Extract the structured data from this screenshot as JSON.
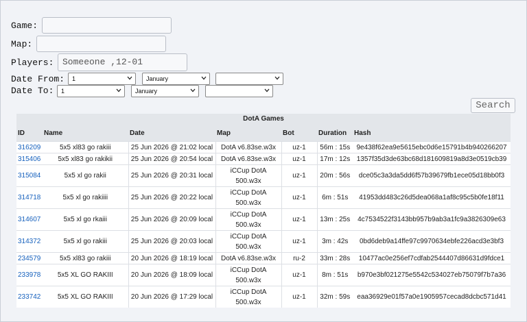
{
  "form": {
    "game_label": "Game:",
    "game_value": "",
    "map_label": "Map:",
    "map_value": "",
    "players_label": "Players:",
    "players_value": "Someeone ,12-01",
    "date_from_label": "Date From:",
    "date_to_label": "Date To:",
    "from_day": "1",
    "from_month": "January",
    "from_year": "",
    "to_day": "1",
    "to_month": "January",
    "to_year": "",
    "search_label": "Search"
  },
  "table": {
    "caption": "DotA Games",
    "headers": [
      "ID",
      "Name",
      "Date",
      "Map",
      "Bot",
      "Duration",
      "Hash"
    ],
    "rows": [
      {
        "id": "316209",
        "name": "5x5 xl83 go rakiii",
        "date": "25 Jun 2026 @ 21:02 local",
        "map": "DotA v6.83se.w3x",
        "bot": "uz-1",
        "duration": "56m : 15s",
        "hash": "9e438f62ea9e5615ebc0d6e15791b4b940266207"
      },
      {
        "id": "315406",
        "name": "5x5 xl83 go rakikii",
        "date": "25 Jun 2026 @ 20:54 local",
        "map": "DotA v6.83se.w3x",
        "bot": "uz-1",
        "duration": "17m : 12s",
        "hash": "1357f35d3de63bc68d181609819a8d3e0519cb39"
      },
      {
        "id": "315084",
        "name": "5x5 xl go rakii",
        "date": "25 Jun 2026 @ 20:31 local",
        "map": "iCCup DotA 500.w3x",
        "bot": "uz-1",
        "duration": "20m : 56s",
        "hash": "dce05c3a3da5dd6f57b39679fb1ece05d18bb0f3"
      },
      {
        "id": "314718",
        "name": "5x5 xl go rakiiii",
        "date": "25 Jun 2026 @ 20:22 local",
        "map": "iCCup DotA 500.w3x",
        "bot": "uz-1",
        "duration": "6m : 51s",
        "hash": "41953dd483c26d5dea068a1af8c95c5b0fe18f11"
      },
      {
        "id": "314607",
        "name": "5x5 xl go rkaiii",
        "date": "25 Jun 2026 @ 20:09 local",
        "map": "iCCup DotA 500.w3x",
        "bot": "uz-1",
        "duration": "13m : 25s",
        "hash": "4c7534522f3143bb957b9ab3a1fc9a3826309e63"
      },
      {
        "id": "314372",
        "name": "5x5 xl go rakiii",
        "date": "25 Jun 2026 @ 20:03 local",
        "map": "iCCup DotA 500.w3x",
        "bot": "uz-1",
        "duration": "3m : 42s",
        "hash": "0bd6deb9a14ffe97c9970634ebfe226acd3e3bf3"
      },
      {
        "id": "234579",
        "name": "5x5 xl83 go rakiii",
        "date": "20 Jun 2026 @ 18:19 local",
        "map": "DotA v6.83se.w3x",
        "bot": "ru-2",
        "duration": "33m : 28s",
        "hash": "10477ac0e256ef7cdfab2544407d86631d9fdce1"
      },
      {
        "id": "233978",
        "name": "5x5 XL GO RAKIII",
        "date": "20 Jun 2026 @ 18:09 local",
        "map": "iCCup DotA 500.w3x",
        "bot": "uz-1",
        "duration": "8m : 51s",
        "hash": "b970e3bf021275e5542c534027eb75079f7b7a36"
      },
      {
        "id": "233742",
        "name": "5x5 XL GO RAKIII",
        "date": "20 Jun 2026 @ 17:29 local",
        "map": "iCCup DotA 500.w3x",
        "bot": "uz-1",
        "duration": "32m : 59s",
        "hash": "eaa36929e01f57a0e1905957cecad8dcbc571d41"
      }
    ]
  },
  "colors": {
    "link": "#1560bd",
    "header_bg": "#e3e6ea",
    "page_bg": "#f1f3f7"
  },
  "icons": {
    "select_arrow": "chevron-down-icon"
  }
}
